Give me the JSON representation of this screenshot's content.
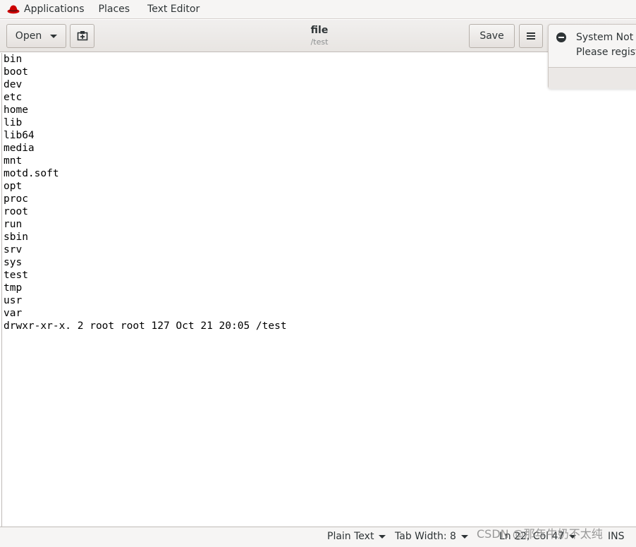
{
  "top_panel": {
    "applications_label": "Applications",
    "places_label": "Places",
    "app_name_label": "Text Editor",
    "logo_color": "#cc0000"
  },
  "headerbar": {
    "open_label": "Open",
    "new_document_icon": "new-document-icon",
    "title": "file",
    "subtitle": "/test",
    "save_label": "Save",
    "menu_icon": "hamburger-menu-icon"
  },
  "notification": {
    "icon": "minus-circle-icon",
    "title": "System Not R",
    "body": "Please registe"
  },
  "document": {
    "lines": [
      "bin",
      "boot",
      "dev",
      "etc",
      "home",
      "lib",
      "lib64",
      "media",
      "mnt",
      "motd.soft",
      "opt",
      "proc",
      "root",
      "run",
      "sbin",
      "srv",
      "sys",
      "test",
      "tmp",
      "usr",
      "var",
      "drwxr-xr-x. 2 root root 127 Oct 21 20:05 /test"
    ]
  },
  "statusbar": {
    "language_label": "Plain Text",
    "tab_width_label": "Tab Width: 8",
    "position_label": "Ln 22, Col 47",
    "mode_label": "INS"
  },
  "watermark": "CSDN @那年牛奶不太纯"
}
